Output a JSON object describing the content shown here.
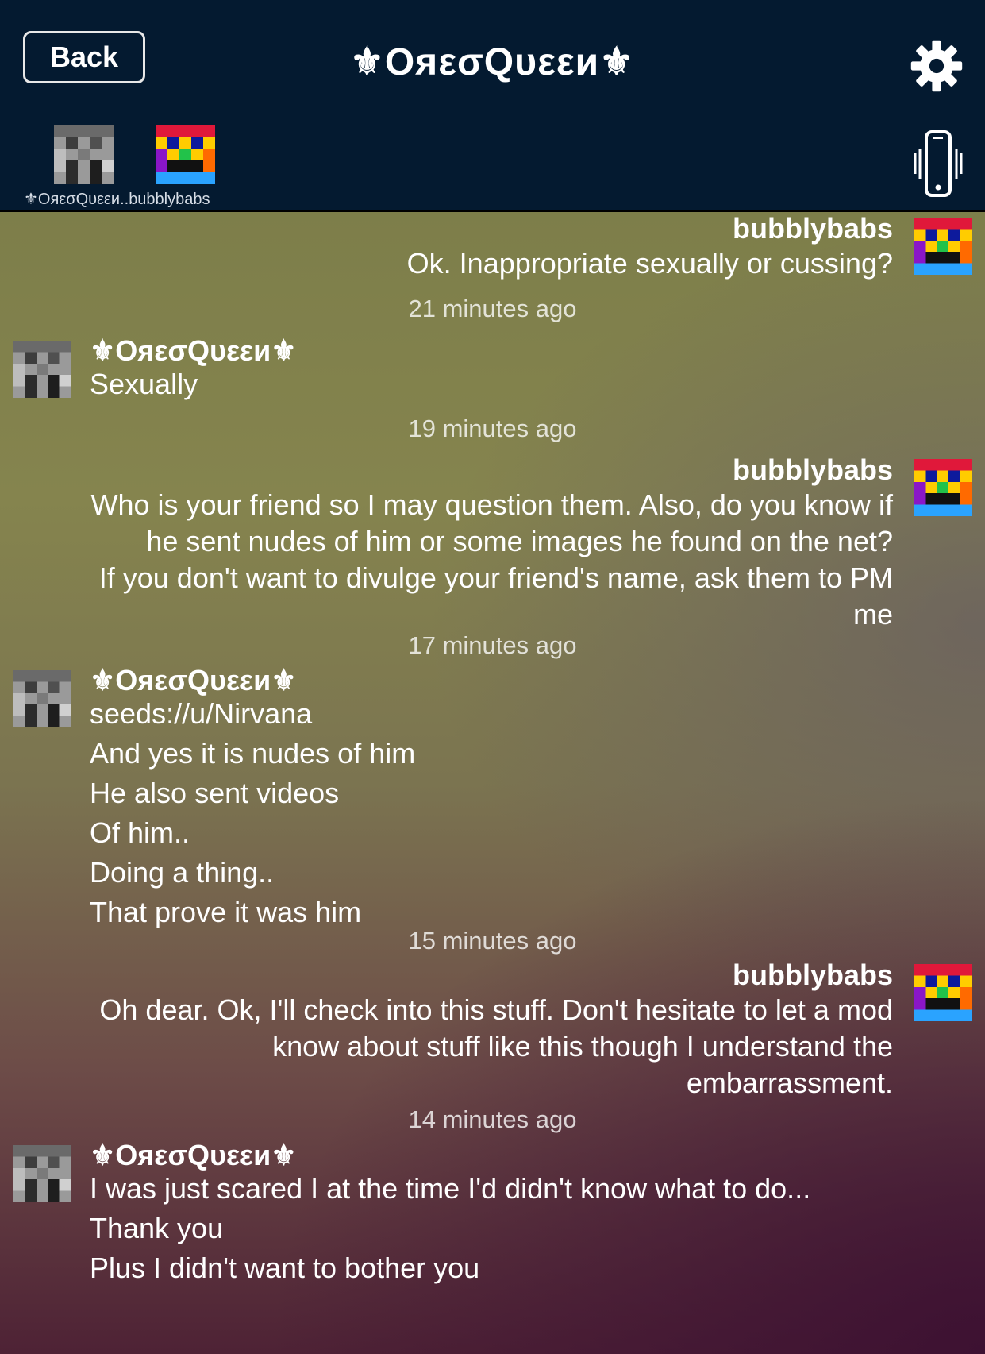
{
  "header": {
    "back_label": "Back",
    "title": "⚜OяεσQυεεи⚜",
    "participants_label": "⚜OяεσQυεεи..bubblybabs",
    "icons": [
      "gear-icon",
      "vibrate-phone-icon"
    ]
  },
  "messages": [
    {
      "sender": "bubblybabs",
      "side": "right",
      "lines": [
        "Ok.  Inappropriate sexually or cussing?"
      ],
      "time": "21 minutes ago"
    },
    {
      "sender": "⚜OяεσQυεεи⚜",
      "side": "left",
      "lines": [
        "Sexually"
      ],
      "time": "19 minutes ago"
    },
    {
      "sender": "bubblybabs",
      "side": "right",
      "lines": [
        "Who is your friend so I may question them.  Also, do you know if",
        "he sent nudes of him or some images he found on the net?",
        "If you don't want to divulge your friend's name, ask them to PM",
        "me"
      ],
      "time": "17 minutes ago"
    },
    {
      "sender": "⚜OяεσQυεεи⚜",
      "side": "left",
      "lines": [
        "seeds://u/Nirvana",
        "And yes it is nudes of him",
        "He also sent videos",
        "Of him..",
        "Doing a thing..",
        "That prove it was him"
      ],
      "time": "15 minutes ago"
    },
    {
      "sender": "bubblybabs",
      "side": "right",
      "lines": [
        "Oh dear.  Ok, I'll check into this stuff.  Don't hesitate to let a mod",
        "know about stuff like this though I understand the",
        "embarrassment."
      ],
      "time": "14 minutes ago"
    },
    {
      "sender": "⚜OяεσQυεεи⚜",
      "side": "left",
      "lines": [
        "I was just scared I at the time I'd didn't know what to do...",
        "Thank you",
        "Plus I didn't want to bother you"
      ],
      "time": ""
    }
  ],
  "colors": {
    "header_bg": "#041a30",
    "text": "#ffffff",
    "timestamp": "#d9d9d9"
  }
}
